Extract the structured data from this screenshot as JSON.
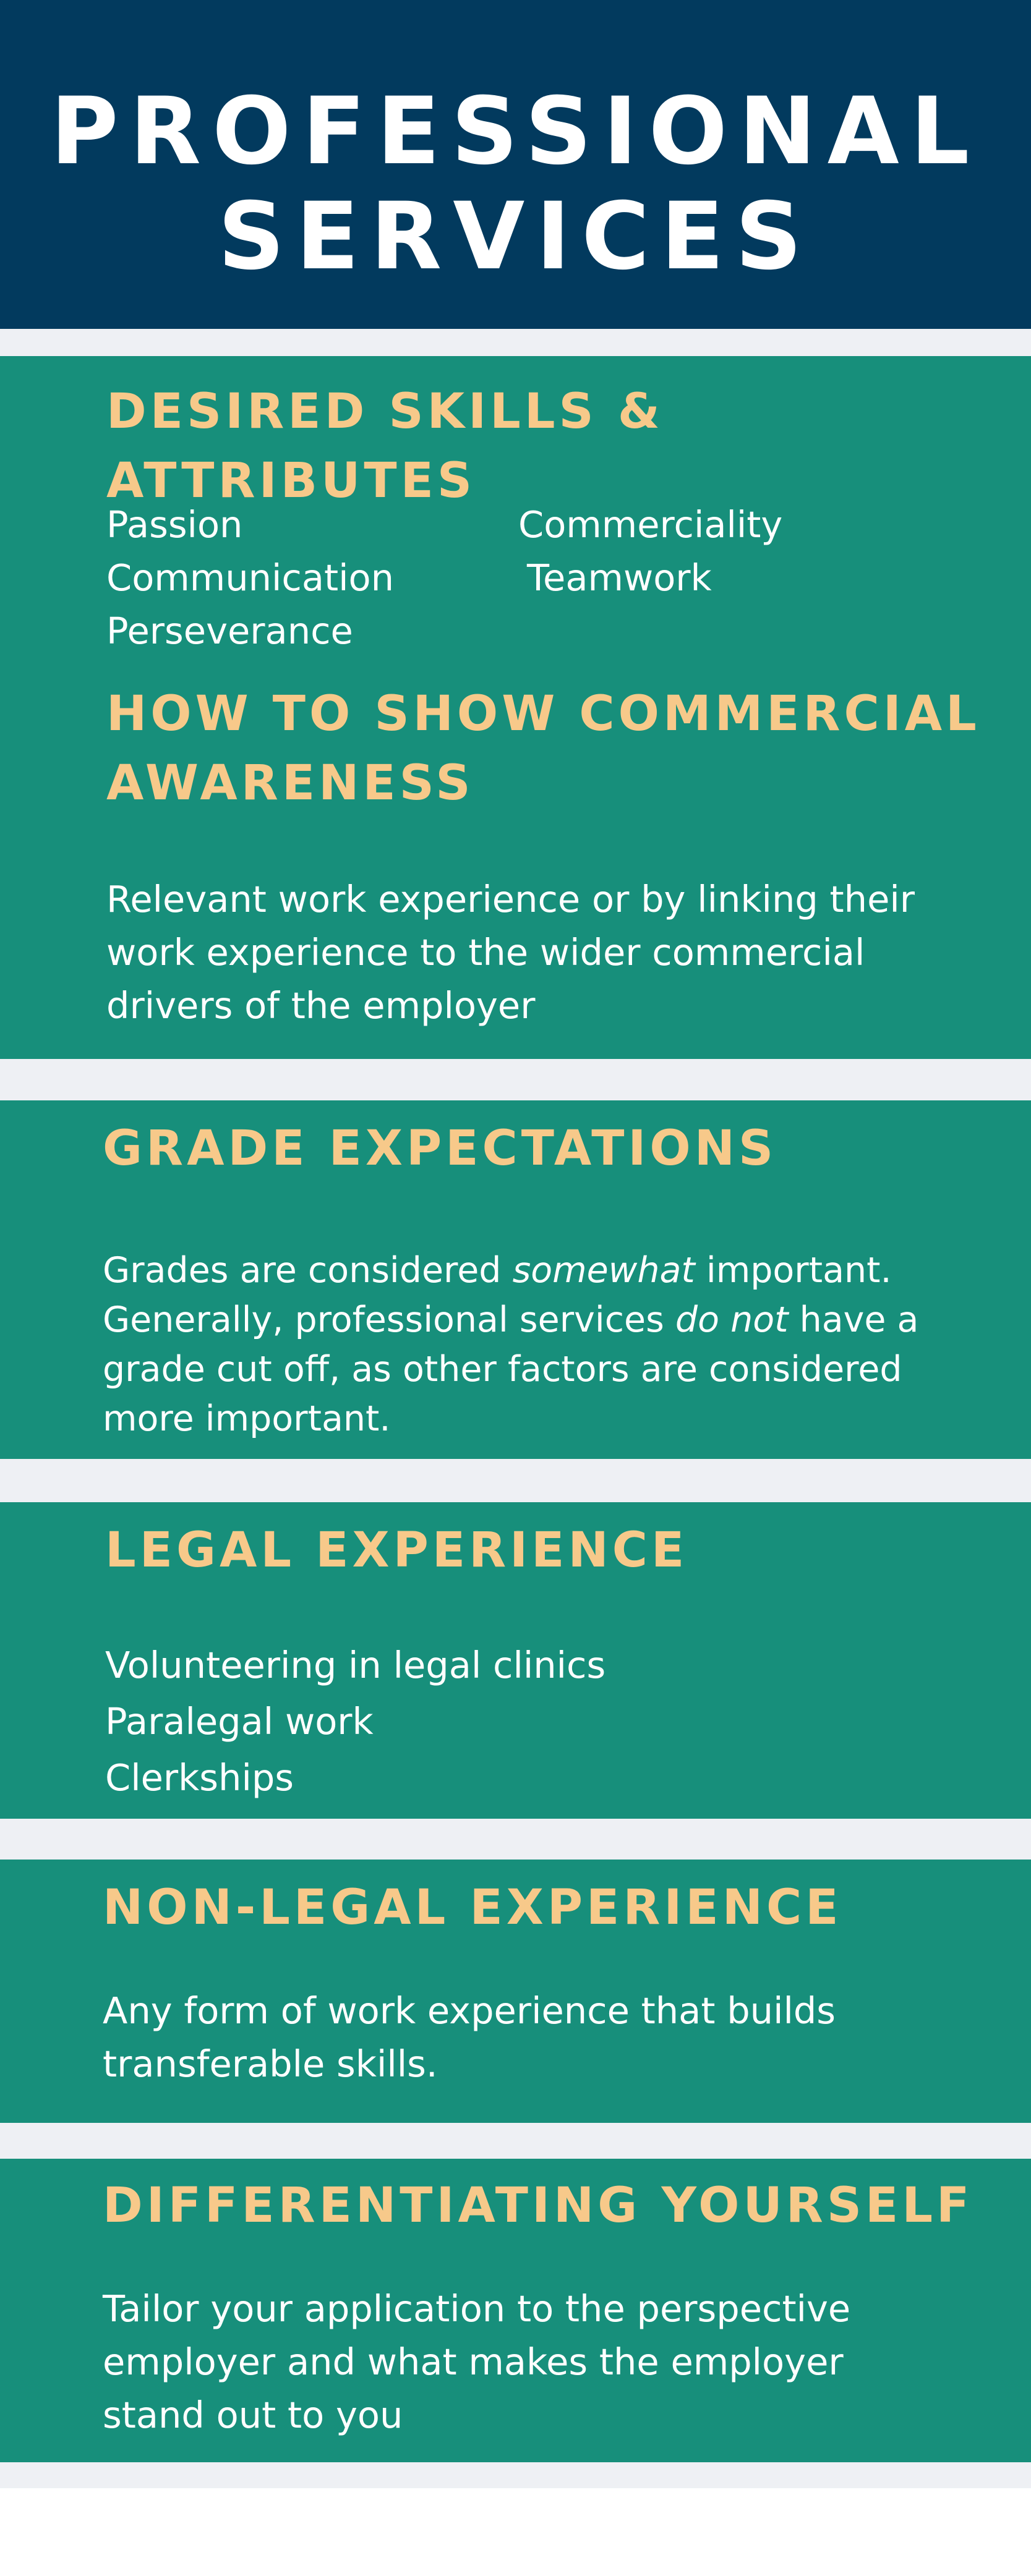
{
  "title": {
    "line1": "PROFESSIONAL",
    "line2": "SERVICES"
  },
  "skills": {
    "heading": "DESIRED SKILLS & ATTRIBUTES",
    "left": [
      "Passion",
      "Communication",
      "Perseverance"
    ],
    "right": [
      "Commerciality",
      "Teamwork"
    ]
  },
  "commercial": {
    "heading_line1": "HOW TO SHOW COMMERCIAL",
    "heading_line2": "AWARENESS",
    "lines": [
      "Relevant work experience or by linking their",
      "work experience to the wider commercial",
      "drivers of the employer"
    ]
  },
  "grades": {
    "heading": "GRADE EXPECTATIONS",
    "p1_before": "Grades are considered ",
    "p1_emph": "somewhat",
    "p1_after": " important.",
    "p2_before": "Generally, professional services ",
    "p2_emph": "do not",
    "p2_after": " have a",
    "line3": "grade cut off, as other factors are considered",
    "line4": "more important."
  },
  "legal": {
    "heading": "LEGAL EXPERIENCE",
    "items": [
      "Volunteering in legal clinics",
      "Paralegal work",
      "Clerkships"
    ]
  },
  "nonlegal": {
    "heading": "NON-LEGAL EXPERIENCE",
    "lines": [
      "Any form of work experience that builds",
      "transferable skills."
    ]
  },
  "differentiating": {
    "heading": "DIFFERENTIATING YOURSELF",
    "lines": [
      "Tailor your application to the perspective",
      "employer and what makes the employer",
      "stand out to you"
    ]
  },
  "colors": {
    "header_bg": "#023a5e",
    "panel_bg": "#178f7b",
    "heading": "#f7c98a",
    "gap": "#eef0f4",
    "text": "#ffffff"
  }
}
